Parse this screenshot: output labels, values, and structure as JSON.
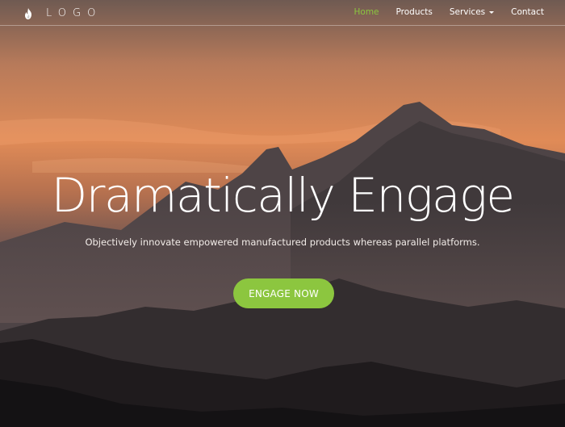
{
  "header": {
    "logo_text": "LOGO",
    "logo_icon": "flame-icon",
    "nav": [
      {
        "label": "Home",
        "active": true
      },
      {
        "label": "Products",
        "active": false
      },
      {
        "label": "Services",
        "active": false,
        "has_dropdown": true
      },
      {
        "label": "Contact",
        "active": false
      }
    ]
  },
  "hero": {
    "headline": "Dramatically Engage",
    "subtext": "Objectively innovate empowered manufactured products whereas parallel platforms.",
    "cta_label": "ENGAGE NOW"
  },
  "colors": {
    "accent": "#8cc63f",
    "text": "#ffffff",
    "sky_warm": "#d98a60",
    "mountain_dark": "#242224"
  }
}
